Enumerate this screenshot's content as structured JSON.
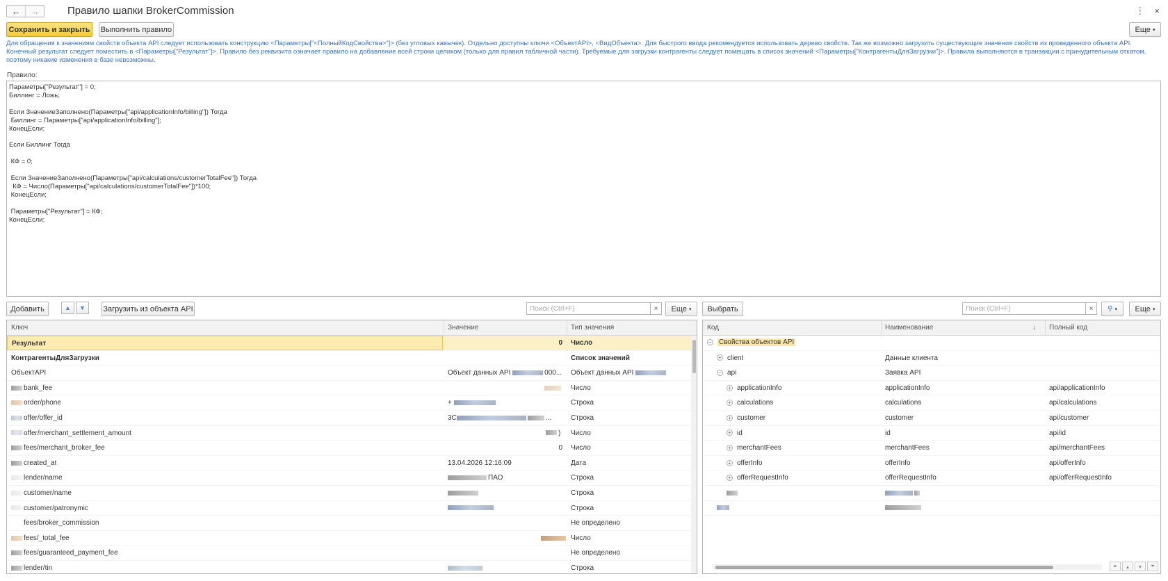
{
  "window": {
    "title": "Правило шапки BrokerCommission",
    "back_icon": "←",
    "forward_icon": "→",
    "menu_icon": "⋮",
    "close_icon": "×"
  },
  "toolbar": {
    "save_close": "Сохранить и закрыть",
    "run_rule": "Выполнить правило",
    "more": "Еще"
  },
  "hint": "Для обращения к значениям свойств объекта API следует использовать конструкцию <Параметры[\"<ПолныйКодСвойства>\"]> (без угловых кавычек). Отдельно доступны ключи <ОбъектAPI>, <ВидОбъекта>. Для быстрого ввода рекомендуется использовать дерево свойств. Так же возможно загрузить существующие значения свойств из проведенного объекта API. Конечный результат следует поместить в <Параметры[\"Результат\"]>. Правило без реквизита означает правило на добавление всей строки целиком (только для правил табличной части). Требуемые для загрузки контрагенты следует помещать в список значений <Параметры[\"КонтрагентыДляЗагрузки\"]>. Правила выполняются в транзакции с принудительным откатом, поэтому никакие изменения в базе невозможны.",
  "rule": {
    "label": "Правило:",
    "code": "Параметры[\"Результат\"] = 0;\nБиллинг = Ложь;\n\nЕсли ЗначениеЗаполнено(Параметры[\"api/applicationInfo/billing\"]) Тогда\n Биллинг = Параметры[\"api/applicationInfo/billing\"];\nКонецЕсли;\n\nЕсли Биллинг Тогда\n\n КФ = 0;\n\n Если ЗначениеЗаполнено(Параметры[\"api/calculations/customerTotalFee\"]) Тогда\n  КФ = Число(Параметры[\"api/calculations/customerTotalFee\"])*100;\n КонецЕсли;\n\n Параметры[\"Результат\"] = КФ;\nКонецЕсли;"
  },
  "left": {
    "add": "Добавить",
    "up_icon": "▲",
    "down_icon": "▼",
    "load": "Загрузить из объекта API",
    "search_placeholder": "Поиск (Ctrl+F)",
    "clear_icon": "×",
    "more": "Еще",
    "columns": [
      "Ключ",
      "Значение",
      "Тип значения"
    ],
    "rows": [
      {
        "key": "Результат",
        "value": "0",
        "type": "Число"
      },
      {
        "key": "КонтрагентыДляЗагрузки",
        "value": "",
        "type": "Список значений"
      },
      {
        "key": "ОбъектAPI",
        "value": "Объект данных API",
        "type": "Объект данных API"
      },
      {
        "key": "bank_fee",
        "value": "",
        "type": "Число"
      },
      {
        "key": "order/phone",
        "value": "+",
        "type": "Строка"
      },
      {
        "key": "offer/offer_id",
        "value": "3C",
        "type": "Строка"
      },
      {
        "key": "offer/merchant_settlement_amount",
        "value": ")",
        "type": "Число"
      },
      {
        "key": "fees/merchant_broker_fee",
        "value": "0",
        "type": "Число"
      },
      {
        "key": "created_at",
        "value": "13.04.2026 12:16:09",
        "type": "Дата"
      },
      {
        "key": "lender/name",
        "value": "ПАО",
        "type": "Строка"
      },
      {
        "key": "customer/name",
        "value": "",
        "type": "Строка"
      },
      {
        "key": "customer/patronymic",
        "value": "",
        "type": "Строка"
      },
      {
        "key": "fees/broker_commission",
        "value": "",
        "type": "Не определено"
      },
      {
        "key": "fees/_total_fee",
        "value": "",
        "type": "Число"
      },
      {
        "key": "fees/guaranteed_payment_fee",
        "value": "",
        "type": "Не определено"
      },
      {
        "key": "lender/tin",
        "value": "",
        "type": "Строка"
      }
    ],
    "value_suffix_ellipsis": "000...",
    "id_suffix": "..."
  },
  "right": {
    "select": "Выбрать",
    "search_placeholder": "Поиск (Ctrl+F)",
    "clear_icon": "×",
    "search_icon": "🔍",
    "more": "Еще",
    "columns": [
      "Код",
      "Наименование",
      "Полный код"
    ],
    "sort_icon": "↓",
    "rows": [
      {
        "code": "Свойства объектов API",
        "name": "",
        "full": "",
        "toggle": "−"
      },
      {
        "code": "client",
        "name": "Данные клиента",
        "full": "",
        "toggle": "+"
      },
      {
        "code": "api",
        "name": "Заявка API",
        "full": "",
        "toggle": "−"
      },
      {
        "code": "applicationInfo",
        "name": "applicationInfo",
        "full": "api/applicationInfo",
        "toggle": "+"
      },
      {
        "code": "calculations",
        "name": "calculations",
        "full": "api/calculations",
        "toggle": "+"
      },
      {
        "code": "customer",
        "name": "customer",
        "full": "api/customer",
        "toggle": "+"
      },
      {
        "code": "id",
        "name": "id",
        "full": "api/id",
        "toggle": "+"
      },
      {
        "code": "merchantFees",
        "name": "merchantFees",
        "full": "api/merchantFees",
        "toggle": "+"
      },
      {
        "code": "offerInfo",
        "name": "offerInfo",
        "full": "api/offerInfo",
        "toggle": "+"
      },
      {
        "code": "offerRequestInfo",
        "name": "offerRequestInfo",
        "full": "api/offerRequestInfo",
        "toggle": "+"
      }
    ]
  }
}
